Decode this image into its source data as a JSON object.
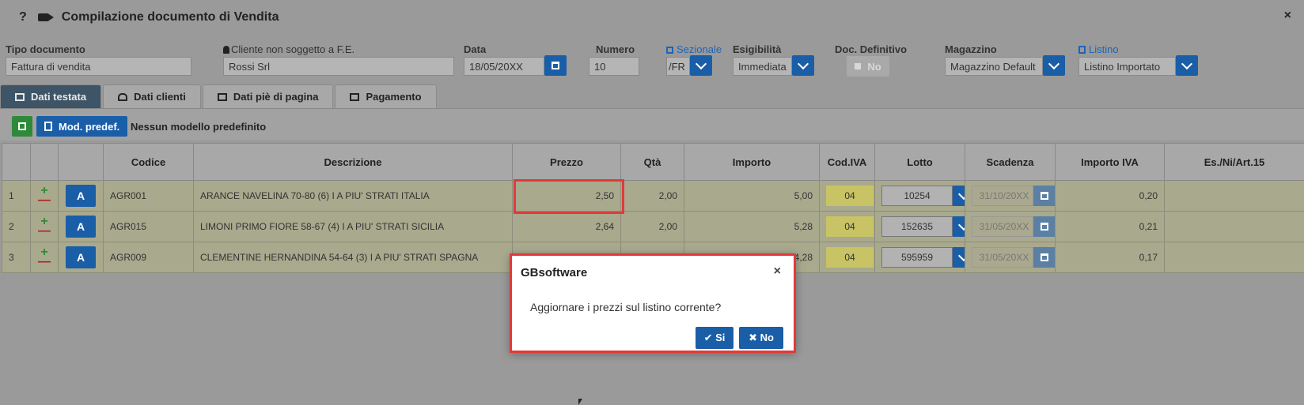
{
  "window": {
    "help_label": "?",
    "camera_icon": "video-camera-icon",
    "title": "Compilazione documento di Vendita",
    "close_label": "×"
  },
  "header": {
    "tipo_documento": {
      "label": "Tipo documento",
      "value": "Fattura di vendita"
    },
    "cliente": {
      "label": "Cliente non soggetto a F.E.",
      "value": "Rossi Srl"
    },
    "data": {
      "label": "Data",
      "value": "18/05/20XX"
    },
    "numero": {
      "label": "Numero",
      "value": "10"
    },
    "sezionale": {
      "label": "Sezionale",
      "value": "/FR"
    },
    "esigibilita": {
      "label": "Esigibilità",
      "value": "Immediata"
    },
    "doc_definitivo": {
      "label": "Doc. Definitivo",
      "value": "No"
    },
    "magazzino": {
      "label": "Magazzino",
      "value": "Magazzino Default"
    },
    "listino": {
      "label": "Listino",
      "value": "Listino Importato"
    }
  },
  "tabs": [
    {
      "label": "Dati testata",
      "active": true
    },
    {
      "label": "Dati clienti",
      "active": false
    },
    {
      "label": "Dati piè di pagina",
      "active": false
    },
    {
      "label": "Pagamento",
      "active": false
    }
  ],
  "toolbar": {
    "mod_predef_label": "Mod. predef.",
    "nessun_modello": "Nessun modello predefinito"
  },
  "table": {
    "columns": [
      "",
      "",
      "",
      "Codice",
      "Descrizione",
      "Prezzo",
      "Qtà",
      "Importo",
      "Cod.IVA",
      "Lotto",
      "Scadenza",
      "Importo IVA",
      "Es./Ni/Art.15"
    ],
    "rows": [
      {
        "n": "1",
        "plus": "+",
        "minus": "—",
        "action": "A",
        "codice": "AGR001",
        "descrizione": "ARANCE NAVELINA 70-80 (6) I A PIU' STRATI     ITALIA",
        "prezzo": "2,50",
        "qta": "2,00",
        "importo": "5,00",
        "cod_iva": "04",
        "lotto": "10254",
        "scadenza": "31/10/20XX",
        "importo_iva": "0,20",
        "es": ""
      },
      {
        "n": "2",
        "plus": "+",
        "minus": "—",
        "action": "A",
        "codice": "AGR015",
        "descrizione": "LIMONI PRIMO FIORE 58-67 (4) I A PIU' STRATI     SICILIA",
        "prezzo": "2,64",
        "qta": "2,00",
        "importo": "5,28",
        "cod_iva": "04",
        "lotto": "152635",
        "scadenza": "31/05/20XX",
        "importo_iva": "0,21",
        "es": ""
      },
      {
        "n": "3",
        "plus": "+",
        "minus": "—",
        "action": "A",
        "codice": "AGR009",
        "descrizione": "CLEMENTINE HERNANDINA 54-64 (3) I A PIU' STRATI     SPAGNA",
        "prezzo": "",
        "qta": "",
        "importo": "4,28",
        "cod_iva": "04",
        "lotto": "595959",
        "scadenza": "31/05/20XX",
        "importo_iva": "0,17",
        "es": ""
      }
    ]
  },
  "dialog": {
    "title": "GBsoftware",
    "close_label": "×",
    "message": "Aggiornare i prezzi sul listino corrente?",
    "yes_label": "✔ Si",
    "no_label": "✖ No"
  },
  "colors": {
    "accent_blue": "#1a5ea8",
    "highlight_red": "#e03a3a",
    "save_green": "#2e8a3a"
  }
}
